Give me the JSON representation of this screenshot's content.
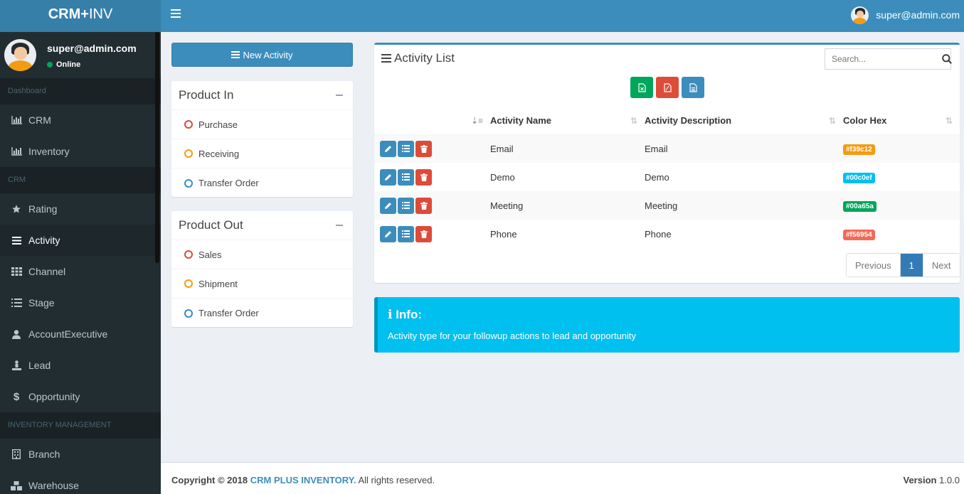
{
  "brand": {
    "bold": "CRM+",
    "light": "INV"
  },
  "navbar": {
    "user_email": "super@admin.com"
  },
  "sidebar": {
    "user_name": "super@admin.com",
    "user_status": "Online",
    "sections": [
      {
        "header": "Dashboard",
        "items": [
          {
            "label": "CRM",
            "icon": "bar-chart-icon"
          },
          {
            "label": "Inventory",
            "icon": "bar-chart-icon"
          }
        ]
      },
      {
        "header": "CRM",
        "items": [
          {
            "label": "Rating",
            "icon": "star-icon"
          },
          {
            "label": "Activity",
            "icon": "bars-icon",
            "active": true
          },
          {
            "label": "Channel",
            "icon": "grid-icon"
          },
          {
            "label": "Stage",
            "icon": "list-icon"
          },
          {
            "label": "AccountExecutive",
            "icon": "user-icon"
          },
          {
            "label": "Lead",
            "icon": "lead-icon"
          },
          {
            "label": "Opportunity",
            "icon": "dollar-icon"
          }
        ]
      },
      {
        "header": "INVENTORY MANAGEMENT",
        "items": [
          {
            "label": "Branch",
            "icon": "building-icon"
          },
          {
            "label": "Warehouse",
            "icon": "cubes-icon"
          }
        ]
      }
    ]
  },
  "new_activity_label": "New Activity",
  "product_in": {
    "title": "Product In",
    "items": [
      {
        "label": "Purchase",
        "color": "#dd4b39"
      },
      {
        "label": "Receiving",
        "color": "#f39c12"
      },
      {
        "label": "Transfer Order",
        "color": "#3c8dbc"
      }
    ]
  },
  "product_out": {
    "title": "Product Out",
    "items": [
      {
        "label": "Sales",
        "color": "#dd4b39"
      },
      {
        "label": "Shipment",
        "color": "#f39c12"
      },
      {
        "label": "Transfer Order",
        "color": "#3c8dbc"
      }
    ]
  },
  "activity_list": {
    "title": "Activity List",
    "search_placeholder": "Search...",
    "columns": [
      "Activity Name",
      "Activity Description",
      "Color Hex"
    ],
    "rows": [
      {
        "name": "Email",
        "description": "Email",
        "color_hex": "#f39c12"
      },
      {
        "name": "Demo",
        "description": "Demo",
        "color_hex": "#00c0ef"
      },
      {
        "name": "Meeting",
        "description": "Meeting",
        "color_hex": "#00a65a"
      },
      {
        "name": "Phone",
        "description": "Phone",
        "color_hex": "#f56954"
      }
    ],
    "pagination": {
      "previous": "Previous",
      "current": "1",
      "next": "Next"
    }
  },
  "info": {
    "title": "Info:",
    "message": "Activity type for your followup actions to lead and opportunity"
  },
  "footer": {
    "copyright_prefix": "Copyright © 2018",
    "brand": "CRM PLUS INVENTORY.",
    "suffix": "All rights reserved.",
    "version_label": "Version",
    "version_value": "1.0.0"
  },
  "colors": {
    "primary": "#3c8dbc",
    "sidebar": "#222d32",
    "success": "#00a65a",
    "danger": "#dd4b39",
    "info": "#00c0ef"
  }
}
